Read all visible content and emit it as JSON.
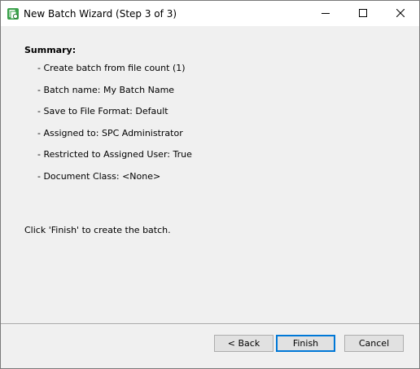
{
  "window": {
    "title": "New Batch Wizard (Step 3 of 3)",
    "icon": "batch-wizard-app-icon"
  },
  "titlebar_controls": {
    "minimize": "minimize-icon",
    "maximize": "maximize-icon",
    "close": "close-icon"
  },
  "summary": {
    "heading": "Summary:",
    "items": [
      "- Create batch from file count (1)",
      "- Batch name: My Batch Name",
      "- Save to File Format: Default",
      "- Assigned to: SPC Administrator",
      "- Restricted to Assigned User: True",
      "- Document Class: <None>"
    ]
  },
  "hint": "Click 'Finish' to create the batch.",
  "buttons": {
    "back": "< Back",
    "finish": "Finish",
    "cancel": "Cancel"
  },
  "colors": {
    "window_background": "#f0f0f0",
    "titlebar_background": "#ffffff",
    "default_button_border": "#0078d7",
    "app_icon_green": "#3aa14a"
  }
}
